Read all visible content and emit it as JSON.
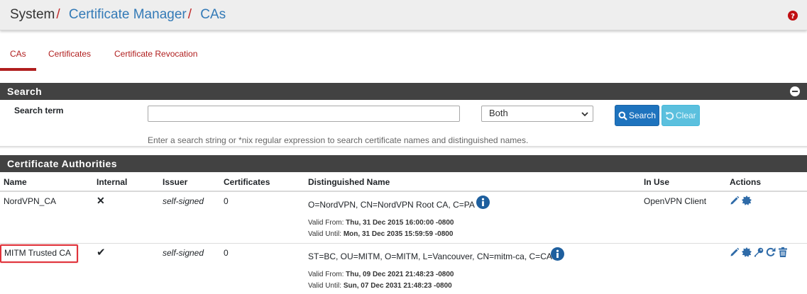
{
  "breadcrumb": {
    "root": "System",
    "sep": "/",
    "item1": "Certificate Manager",
    "item2": "CAs"
  },
  "tabs": [
    {
      "label": "CAs",
      "active": true
    },
    {
      "label": "Certificates",
      "active": false
    },
    {
      "label": "Certificate Revocation",
      "active": false
    }
  ],
  "search_panel": {
    "title": "Search",
    "term_label": "Search term",
    "input_value": "",
    "scope_selected": "Both",
    "search_button": "Search",
    "clear_button": "Clear",
    "help": "Enter a search string or *nix regular expression to search certificate names and distinguished names."
  },
  "table": {
    "title": "Certificate Authorities",
    "headers": [
      "Name",
      "Internal",
      "Issuer",
      "Certificates",
      "Distinguished Name",
      "In Use",
      "Actions"
    ],
    "rows": [
      {
        "name": "NordVPN_CA",
        "internal": "✕",
        "issuer": "self-signed",
        "certificates": "0",
        "dn": "O=NordVPN, CN=NordVPN Root CA, C=PA",
        "valid_from_label": "Valid From:",
        "valid_from": "Thu, 31 Dec 2015 16:00:00 -0800",
        "valid_until_label": "Valid Until:",
        "valid_until": "Mon, 31 Dec 2035 15:59:59 -0800",
        "in_use": "OpenVPN Client",
        "actions": [
          "pencil-icon",
          "cert-icon"
        ]
      },
      {
        "name": "MITM Trusted CA",
        "internal": "✔",
        "issuer": "self-signed",
        "certificates": "0",
        "dn": "ST=BC, OU=MITM, O=MITM, L=Vancouver, CN=mitm-ca, C=CA",
        "valid_from_label": "Valid From:",
        "valid_from": "Thu, 09 Dec 2021 21:48:23 -0800",
        "valid_until_label": "Valid Until:",
        "valid_until": "Sun, 07 Dec 2031 21:48:23 -0800",
        "in_use": "",
        "actions": [
          "pencil-icon",
          "cert-icon",
          "key-icon",
          "refresh-icon",
          "trash-icon"
        ]
      }
    ]
  },
  "colors": {
    "link": "#337ab7",
    "accent_red": "#b01e1e",
    "panel_heading": "#424242",
    "primary_btn": "#1e73be",
    "info_btn": "#5bc0de",
    "highlight": "#e0323a"
  }
}
